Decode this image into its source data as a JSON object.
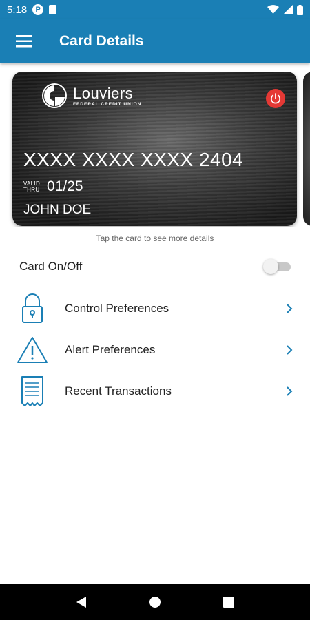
{
  "status_bar": {
    "time": "5:18",
    "p_icon_letter": "P"
  },
  "app_bar": {
    "title": "Card Details"
  },
  "card": {
    "issuer_name": "Louviers",
    "issuer_sub": "FEDERAL CREDIT UNION",
    "number": "XXXX XXXX XXXX 2404",
    "valid_label_1": "VALID",
    "valid_label_2": "THRU",
    "expiry": "01/25",
    "holder": "JOHN DOE"
  },
  "hint": "Tap the card to see more details",
  "card_toggle": {
    "label": "Card On/Off",
    "state": "off"
  },
  "menu": [
    {
      "label": "Control Preferences",
      "icon": "lock-icon"
    },
    {
      "label": "Alert Preferences",
      "icon": "warning-icon"
    },
    {
      "label": "Recent Transactions",
      "icon": "receipt-icon"
    }
  ],
  "colors": {
    "primary": "#1a7fb5",
    "power": "#e53935",
    "icon": "#1a7fb5"
  }
}
